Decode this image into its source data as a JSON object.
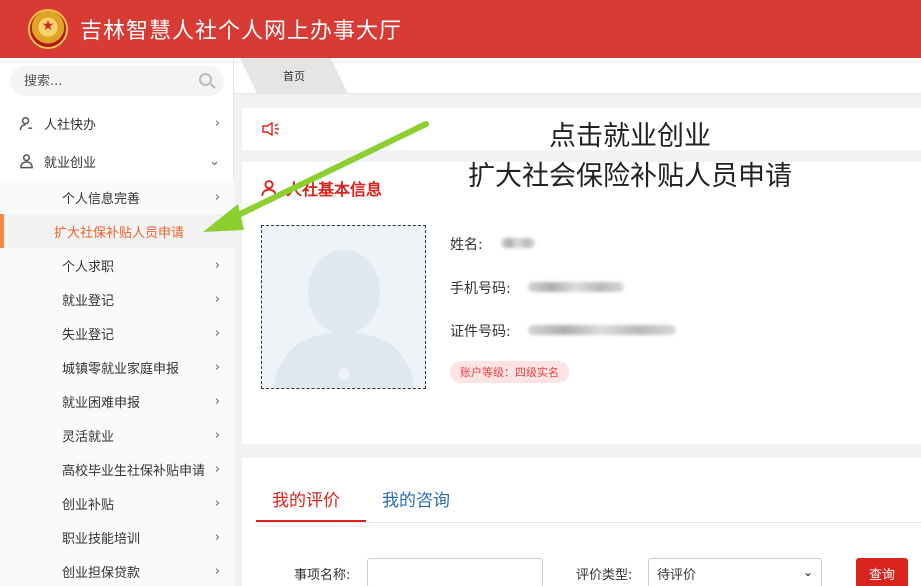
{
  "header": {
    "title": "吉林智慧人社个人网上办事大厅"
  },
  "sidebar": {
    "search_placeholder": "搜索...",
    "top_items": [
      {
        "label": "人社快办",
        "icon": "user-icon",
        "chevron": "›"
      },
      {
        "label": "就业创业",
        "icon": "users-icon",
        "chevron": "⌄"
      }
    ],
    "sub_items": [
      {
        "label": "个人信息完善",
        "chevron": "›"
      },
      {
        "label": "扩大社保补贴人员申请",
        "chevron": ""
      },
      {
        "label": "个人求职",
        "chevron": "›"
      },
      {
        "label": "就业登记",
        "chevron": "›"
      },
      {
        "label": "失业登记",
        "chevron": "›"
      },
      {
        "label": "城镇零就业家庭申报",
        "chevron": "›"
      },
      {
        "label": "就业困难申报",
        "chevron": "›"
      },
      {
        "label": "灵活就业",
        "chevron": "›"
      },
      {
        "label": "高校毕业生社保补贴申请",
        "chevron": "›"
      },
      {
        "label": "创业补贴",
        "chevron": "›"
      },
      {
        "label": "职业技能培训",
        "chevron": "›"
      },
      {
        "label": "创业担保贷款",
        "chevron": "›"
      }
    ],
    "active_index": 1
  },
  "tabs": {
    "home": "首页"
  },
  "info_card": {
    "title": "人社基本信息",
    "name_label": "姓名:",
    "phone_label": "手机号码:",
    "id_label": "证件号码:",
    "badge": "账户等级：四级实名"
  },
  "evaluation": {
    "tab_active": "我的评价",
    "tab_inactive": "我的咨询",
    "item_label": "事项名称:",
    "type_label": "评价类型:",
    "type_value": "待评价",
    "query_button": "查询"
  },
  "annotation": {
    "line1": "点击就业创业",
    "line2": "扩大社会保险补贴人员申请"
  },
  "colors": {
    "header": "#d83a34",
    "active": "#e9642e",
    "arrow": "#8ccf2f"
  }
}
